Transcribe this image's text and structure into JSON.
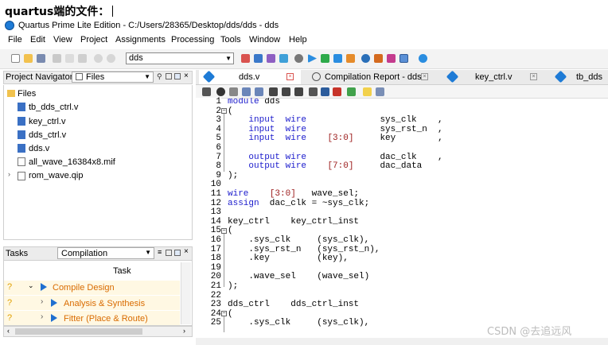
{
  "heading": "quartus端的文件：",
  "window": {
    "title": "Quartus Prime Lite Edition - C:/Users/28365/Desktop/dds/dds - dds"
  },
  "menu": [
    "File",
    "Edit",
    "View",
    "Project",
    "Assignments",
    "Processing",
    "Tools",
    "Window",
    "Help"
  ],
  "toolbar": {
    "entity_select": "dds"
  },
  "project_navigator": {
    "title": "Project Navigator",
    "view_select": "Files",
    "root": "Files",
    "files": [
      "tb_dds_ctrl.v",
      "key_ctrl.v",
      "dds_ctrl.v",
      "dds.v",
      "all_wave_16384x8.mif",
      "rom_wave.qip"
    ]
  },
  "tasks": {
    "title": "Tasks",
    "flow_select": "Compilation",
    "column": "Task",
    "rows": [
      {
        "status": "?",
        "name": "Compile Design"
      },
      {
        "status": "?",
        "name": "Analysis & Synthesis"
      },
      {
        "status": "?",
        "name": "Fitter (Place & Route)"
      }
    ]
  },
  "editor": {
    "tabs": [
      "dds.v",
      "Compilation Report - dds",
      "key_ctrl.v",
      "tb_dds"
    ],
    "line_numbers": [
      "1",
      "2",
      "3",
      "4",
      "5",
      "6",
      "7",
      "8",
      "9",
      "10",
      "11",
      "12",
      "13",
      "14",
      "15",
      "16",
      "17",
      "18",
      "19",
      "20",
      "21",
      "22",
      "23",
      "24",
      "25"
    ],
    "lines": [
      "module dds",
      "(",
      "    input  wire              sys_clk    ,",
      "    input  wire              sys_rst_n  ,",
      "    input  wire    [3:0]     key        ,",
      "",
      "    output wire              dac_clk    ,",
      "    output wire    [7:0]     dac_data",
      ");",
      "",
      "wire    [3:0]   wave_sel;",
      "assign  dac_clk = ~sys_clk;",
      "",
      "key_ctrl    key_ctrl_inst",
      "(",
      "    .sys_clk     (sys_clk),",
      "    .sys_rst_n   (sys_rst_n),",
      "    .key         (key),",
      "",
      "    .wave_sel    (wave_sel)",
      ");",
      "",
      "dds_ctrl    dds_ctrl_inst",
      "(",
      "    .sys_clk     (sys_clk),"
    ]
  },
  "watermark": "CSDN @去追远风"
}
